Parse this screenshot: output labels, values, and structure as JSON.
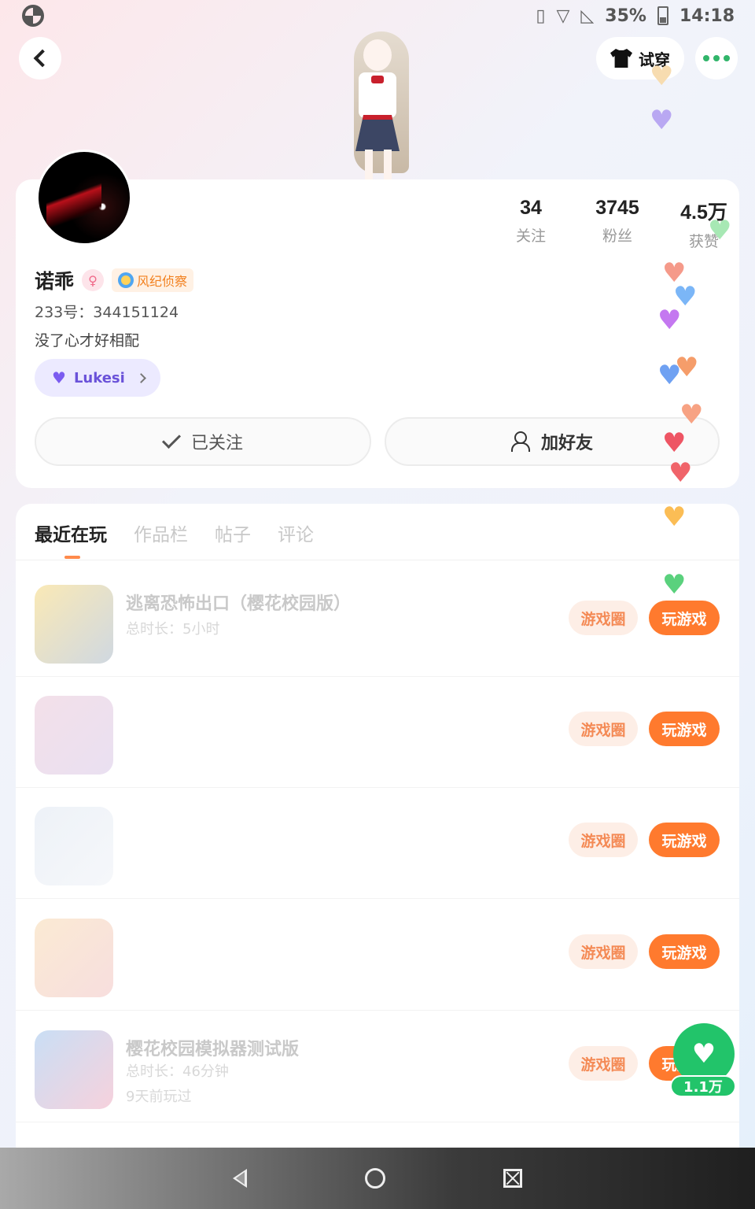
{
  "status_bar": {
    "battery": "35%",
    "time": "14:18"
  },
  "top_nav": {
    "tryon_label": "试穿"
  },
  "stats": [
    {
      "value": "34",
      "label": "关注"
    },
    {
      "value": "3745",
      "label": "粉丝"
    },
    {
      "value": "4.5万",
      "label": "获赞"
    }
  ],
  "profile": {
    "name": "诺乖",
    "badge": "风纪侦察",
    "uid": "233号：344151124",
    "bio": "没了心才好相配",
    "cp_name": "Lukesi"
  },
  "actions": {
    "followed_label": "已关注",
    "add_friend_label": "加好友"
  },
  "tabs": [
    "最近在玩",
    "作品栏",
    "帖子",
    "评论"
  ],
  "games": [
    {
      "title": "逃离恐怖出口（樱花校园版）",
      "duration": "总时长：5小时"
    },
    {
      "title": "",
      "duration": ""
    },
    {
      "title": "",
      "duration": ""
    },
    {
      "title": "",
      "duration": ""
    },
    {
      "title": "樱花校园模拟器测试版",
      "duration": "总时长：46分钟",
      "last_played": "9天前玩过"
    }
  ],
  "game_buttons": {
    "circle": "游戏圈",
    "play": "玩游戏"
  },
  "like": {
    "count": "1.1万"
  },
  "colors": {
    "accent": "#ff7a2e",
    "like_green": "#22c46a",
    "cp_purple": "#6a52d9"
  }
}
